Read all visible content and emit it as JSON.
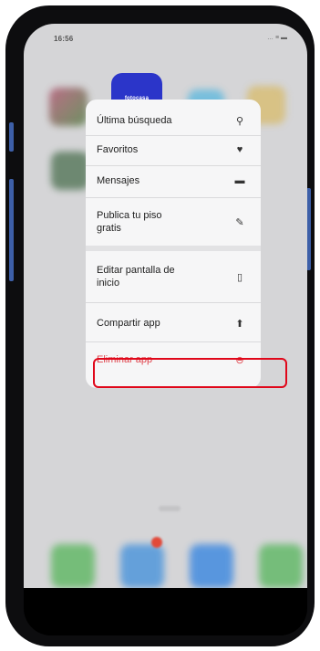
{
  "status_bar": {
    "time": "16:56",
    "icons": "… ≡ ▬"
  },
  "app": {
    "label": "fotocasa"
  },
  "menu": {
    "items": [
      {
        "label": "Última búsqueda",
        "icon": "search-icon",
        "glyph": "⚲"
      },
      {
        "label": "Favoritos",
        "icon": "heart-icon",
        "glyph": "♥"
      },
      {
        "label": "Mensajes",
        "icon": "message-icon",
        "glyph": "▬"
      },
      {
        "label": "Publica tu piso gratis",
        "icon": "edit-icon",
        "glyph": "✎"
      },
      {
        "label": "Editar pantalla de inicio",
        "icon": "phone-icon",
        "glyph": "▯"
      },
      {
        "label": "Compartir app",
        "icon": "share-icon",
        "glyph": "⬆"
      },
      {
        "label": "Eliminar app",
        "icon": "remove-icon",
        "glyph": "⊖"
      }
    ]
  },
  "colors": {
    "accent": "#2b35c9",
    "danger": "#e0444d",
    "highlight": "#e0071a"
  }
}
